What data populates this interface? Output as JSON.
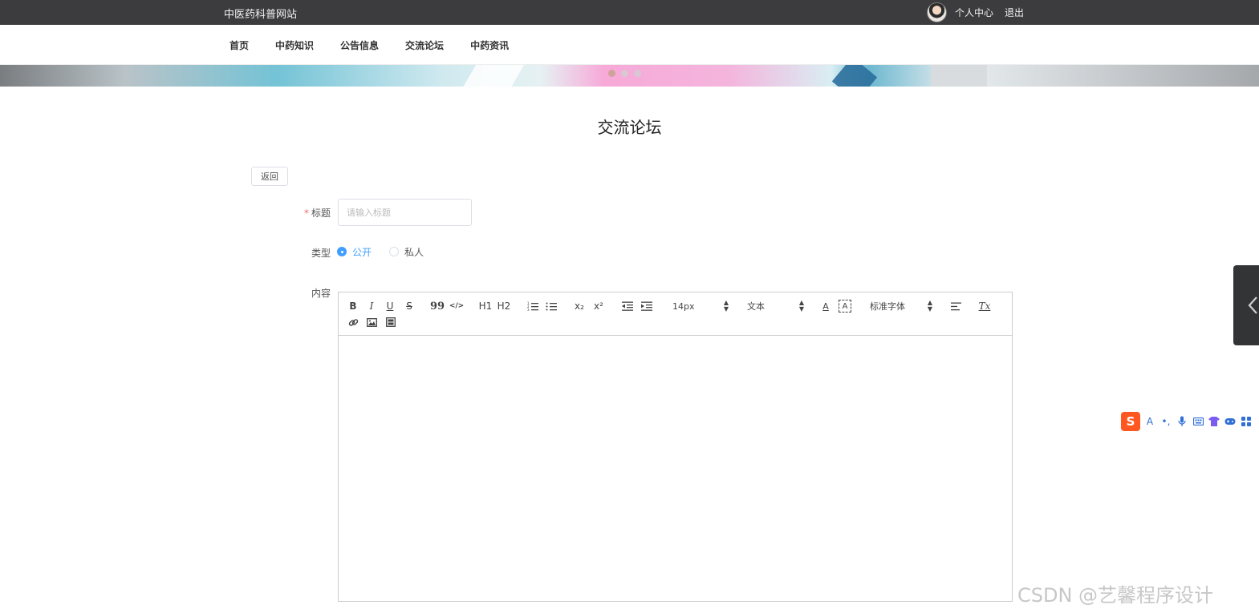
{
  "topbar": {
    "site_title": "中医药科普网站",
    "user_center": "个人中心",
    "logout": "退出"
  },
  "nav": {
    "items": [
      "首页",
      "中药知识",
      "公告信息",
      "交流论坛",
      "中药资讯"
    ]
  },
  "banner": {
    "slide_count": 3,
    "active_slide": 1
  },
  "page": {
    "title": "交流论坛",
    "back_label": "返回"
  },
  "form": {
    "title_label": "标题",
    "title_required_mark": "*",
    "title_placeholder": "请输入标题",
    "title_value": "",
    "type_label": "类型",
    "type_options": [
      "公开",
      "私人"
    ],
    "type_selected": "公开",
    "content_label": "内容"
  },
  "editor": {
    "toolbar": {
      "bold": "B",
      "italic": "I",
      "underline": "U",
      "strike": "S",
      "blockquote": "99",
      "code_block": "</>",
      "h1": "H1",
      "h2": "H2",
      "ordered_list": "ordered-list-icon",
      "bullet_list": "bullet-list-icon",
      "subscript": "x₂",
      "superscript": "x²",
      "outdent": "outdent-icon",
      "indent": "indent-icon",
      "size_value": "14px",
      "header_value": "文本",
      "font_color": "A",
      "background_color": "A",
      "font_value": "标准字体",
      "align": "align-icon",
      "clean": "Tx",
      "link": "link-icon",
      "image": "image-icon",
      "video": "video-icon"
    },
    "content": ""
  },
  "ime": {
    "logo": "S",
    "icons": [
      "A",
      "•,",
      "microphone-icon",
      "keyboard-icon",
      "shirt-icon",
      "gamepad-icon",
      "apps-icon"
    ]
  },
  "watermark": "CSDN @艺馨程序设计",
  "colors": {
    "topbar_bg": "#3c3b3d",
    "accent": "#409eff",
    "required": "#f56c6c"
  }
}
